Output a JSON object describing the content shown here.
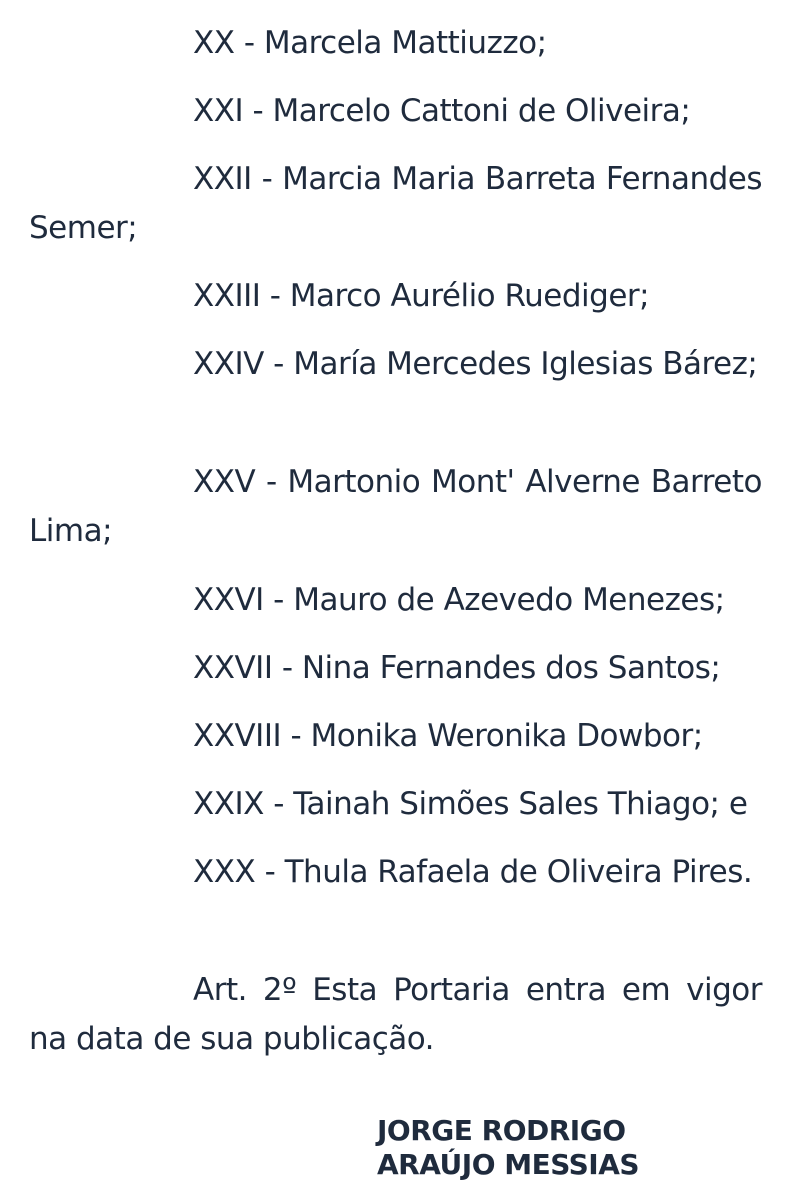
{
  "document": {
    "items": [
      "XX - Marcela Mattiuzzo;",
      "XXI - Marcelo Cattoni de Oliveira;",
      "XXII - Marcia Maria Barreta Fernandes Semer;",
      "XXIII - Marco Aurélio Ruediger;",
      "XXIV - María Mercedes Iglesias Bárez;",
      "XXV - Martonio Mont' Alverne Barreto Lima;",
      "XXVI - Mauro de Azevedo Menezes;",
      "XXVII - Nina Fernandes dos Santos;",
      "XXVIII - Monika Weronika Dowbor;",
      "XXIX - Tainah Simões Sales Thiago; e",
      "XXX - Thula Rafaela de Oliveira Pires."
    ],
    "article": "Art. 2º Esta Portaria entra em vigor na data de sua publicação.",
    "signature": {
      "line1": "JORGE RODRIGO",
      "line2": "ARAÚJO MESSIAS"
    }
  }
}
